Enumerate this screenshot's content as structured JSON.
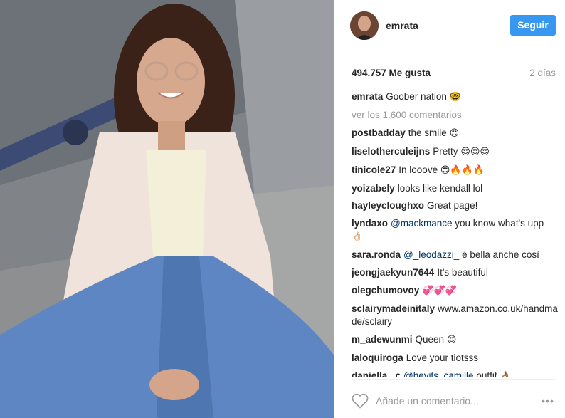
{
  "post": {
    "username": "emrata",
    "follow_label": "Seguir",
    "likes": "494.757 Me gusta",
    "time": "2 días"
  },
  "caption": {
    "user": "emrata",
    "text": "Goober nation",
    "emoji": "🤓"
  },
  "view_all": "ver los 1.600 comentarios",
  "comments": [
    {
      "user": "postbadday",
      "text": "the smile",
      "emoji": "😍",
      "mention": ""
    },
    {
      "user": "liselotherculeijns",
      "text": "Pretty",
      "emoji": "😍😍😍",
      "mention": ""
    },
    {
      "user": "tinicole27",
      "text": "In looove",
      "emoji": "😍🔥🔥🔥",
      "mention": ""
    },
    {
      "user": "yoizabely",
      "text": "looks like kendall lol",
      "emoji": "",
      "mention": ""
    },
    {
      "user": "hayleycloughxo",
      "text": "Great page!",
      "emoji": "",
      "mention": ""
    },
    {
      "user": "lyndaxo",
      "mention": "@mackmance",
      "text": "you know what's upp",
      "emoji": "👌🏻"
    },
    {
      "user": "sara.ronda",
      "mention": "@_leodazzi_",
      "text": "è bella anche così",
      "emoji": ""
    },
    {
      "user": "jeongjaekyun7644",
      "text": "It's beautiful",
      "emoji": "",
      "mention": ""
    },
    {
      "user": "olegchumovoy",
      "text": "",
      "emoji": "💞💞💞",
      "mention": ""
    },
    {
      "user": "sclairymadeinitaly",
      "text": "www.amazon.co.uk/handmade/sclairy",
      "emoji": "",
      "mention": ""
    },
    {
      "user": "m_adewunmi",
      "text": "Queen",
      "emoji": "😍",
      "mention": ""
    },
    {
      "user": "laloquiroga",
      "text": "Love your tiotsss",
      "emoji": "",
      "mention": ""
    },
    {
      "user": "daniella._c",
      "mention": "@heyits_camille",
      "text": "outfit",
      "emoji": "👌🏽"
    }
  ],
  "footer": {
    "comment_placeholder": "Añade un comentario...",
    "more_label": "•••",
    "heart_icon": "heart-outline-icon"
  },
  "colors": {
    "follow_button": "#3897f0",
    "mention": "#003569",
    "muted": "#999999"
  }
}
